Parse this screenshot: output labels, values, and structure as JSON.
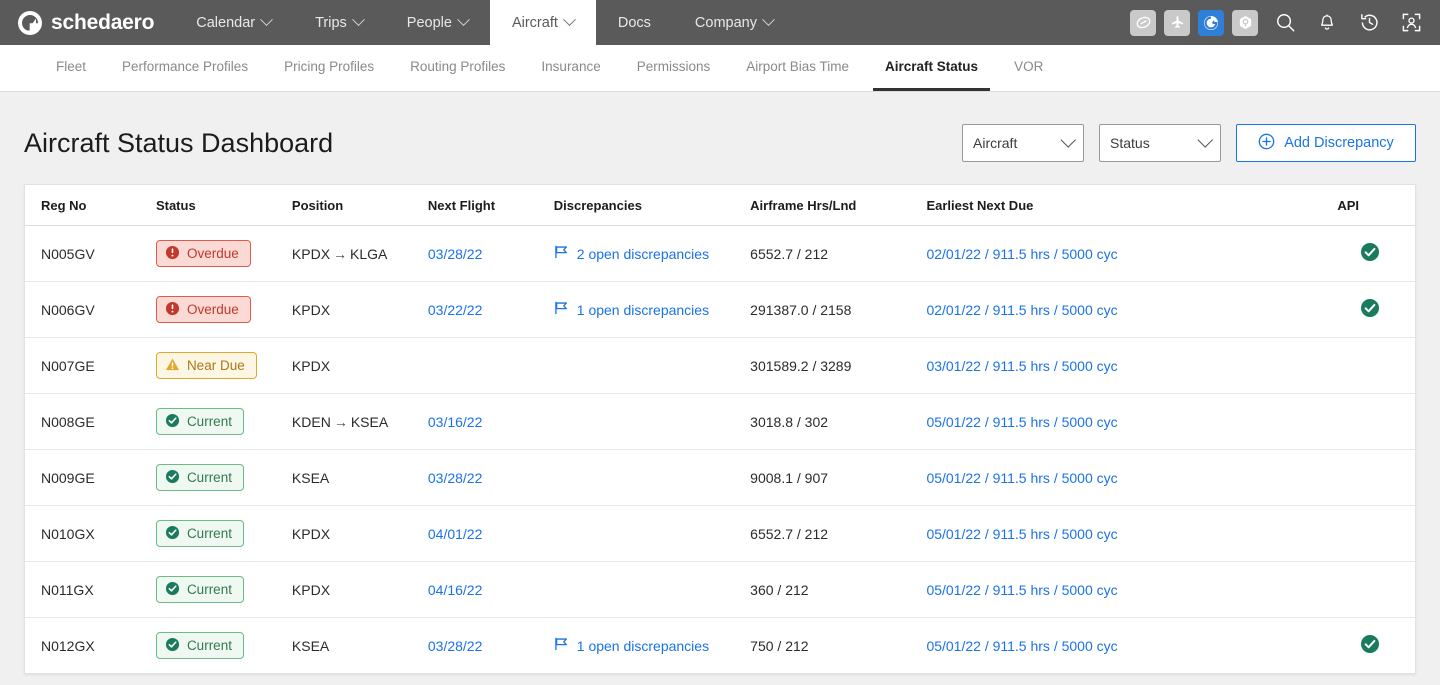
{
  "brand": {
    "name": "schedaero",
    "logo_icon": "swoosh-circle-icon"
  },
  "topnav": {
    "items": [
      {
        "label": "Calendar",
        "has_caret": true,
        "active": false
      },
      {
        "label": "Trips",
        "has_caret": true,
        "active": false
      },
      {
        "label": "People",
        "has_caret": true,
        "active": false
      },
      {
        "label": "Aircraft",
        "has_caret": true,
        "active": true
      },
      {
        "label": "Docs",
        "has_caret": false,
        "active": false
      },
      {
        "label": "Company",
        "has_caret": true,
        "active": false
      }
    ],
    "app_tiles": [
      {
        "icon": "meatball-swoosh-icon",
        "selected": false
      },
      {
        "icon": "airplane-icon",
        "selected": false
      },
      {
        "icon": "schedaero-icon",
        "selected": true
      },
      {
        "icon": "hexagon-p-icon",
        "selected": false
      }
    ],
    "icons": [
      {
        "icon": "search-icon"
      },
      {
        "icon": "bell-icon"
      },
      {
        "icon": "history-clock-icon"
      },
      {
        "icon": "user-frame-icon"
      }
    ],
    "accent_selected": "#2f7ed8",
    "bar_color": "#5a5a5a"
  },
  "subnav": {
    "items": [
      {
        "label": "Fleet",
        "active": false
      },
      {
        "label": "Performance Profiles",
        "active": false
      },
      {
        "label": "Pricing Profiles",
        "active": false
      },
      {
        "label": "Routing Profiles",
        "active": false
      },
      {
        "label": "Insurance",
        "active": false
      },
      {
        "label": "Permissions",
        "active": false
      },
      {
        "label": "Airport Bias Time",
        "active": false
      },
      {
        "label": "Aircraft Status",
        "active": true
      },
      {
        "label": "VOR",
        "active": false
      }
    ]
  },
  "page": {
    "title": "Aircraft Status Dashboard",
    "filter_aircraft": {
      "value": "Aircraft",
      "icon": "chevron-down-icon"
    },
    "filter_status": {
      "value": "Status",
      "icon": "chevron-down-icon"
    },
    "add_button": {
      "label": "Add Discrepancy",
      "icon": "plus-circle-icon",
      "color": "#1a73e8"
    }
  },
  "table": {
    "columns": [
      "Reg No",
      "Status",
      "Position",
      "Next Flight",
      "Discrepancies",
      "Airframe Hrs/Lnd",
      "Earliest Next Due",
      "API"
    ],
    "rows": [
      {
        "reg_no": "N005GV",
        "status": {
          "label": "Overdue",
          "kind": "overdue",
          "icon": "exclamation-circle-icon"
        },
        "position": {
          "from": "KPDX",
          "to": "KLGA",
          "text": "KPDX → KLGA"
        },
        "next_flight": "03/28/22",
        "discrepancies": {
          "label": "2 open discrepancies",
          "icon": "flag-icon"
        },
        "airframe": "6552.7 / 212",
        "earliest_next_due": "02/01/22 / 911.5 hrs / 5000 cyc",
        "api": true
      },
      {
        "reg_no": "N006GV",
        "status": {
          "label": "Overdue",
          "kind": "overdue",
          "icon": "exclamation-circle-icon"
        },
        "position": {
          "from": "KPDX",
          "to": "",
          "text": "KPDX"
        },
        "next_flight": "03/22/22",
        "discrepancies": {
          "label": "1 open discrepancies",
          "icon": "flag-icon"
        },
        "airframe": "291387.0 / 2158",
        "earliest_next_due": "02/01/22 / 911.5 hrs / 5000 cyc",
        "api": true
      },
      {
        "reg_no": "N007GE",
        "status": {
          "label": "Near Due",
          "kind": "neardue",
          "icon": "warning-triangle-icon"
        },
        "position": {
          "from": "KPDX",
          "to": "",
          "text": "KPDX"
        },
        "next_flight": "",
        "discrepancies": null,
        "airframe": "301589.2 / 3289",
        "earliest_next_due": "03/01/22 / 911.5 hrs / 5000 cyc",
        "api": false
      },
      {
        "reg_no": "N008GE",
        "status": {
          "label": "Current",
          "kind": "current",
          "icon": "check-circle-icon"
        },
        "position": {
          "from": "KDEN",
          "to": "KSEA",
          "text": "KDEN → KSEA"
        },
        "next_flight": "03/16/22",
        "discrepancies": null,
        "airframe": "3018.8 / 302",
        "earliest_next_due": "05/01/22 / 911.5 hrs / 5000 cyc",
        "api": false
      },
      {
        "reg_no": "N009GE",
        "status": {
          "label": "Current",
          "kind": "current",
          "icon": "check-circle-icon"
        },
        "position": {
          "from": "KSEA",
          "to": "",
          "text": "KSEA"
        },
        "next_flight": "03/28/22",
        "discrepancies": null,
        "airframe": "9008.1 / 907",
        "earliest_next_due": "05/01/22 / 911.5 hrs / 5000 cyc",
        "api": false
      },
      {
        "reg_no": "N010GX",
        "status": {
          "label": "Current",
          "kind": "current",
          "icon": "check-circle-icon"
        },
        "position": {
          "from": "KPDX",
          "to": "",
          "text": "KPDX"
        },
        "next_flight": "04/01/22",
        "discrepancies": null,
        "airframe": "6552.7 / 212",
        "earliest_next_due": "05/01/22 / 911.5 hrs / 5000 cyc",
        "api": false
      },
      {
        "reg_no": "N011GX",
        "status": {
          "label": "Current",
          "kind": "current",
          "icon": "check-circle-icon"
        },
        "position": {
          "from": "KPDX",
          "to": "",
          "text": "KPDX"
        },
        "next_flight": "04/16/22",
        "discrepancies": null,
        "airframe": "360 / 212",
        "earliest_next_due": "05/01/22 / 911.5 hrs / 5000 cyc",
        "api": false
      },
      {
        "reg_no": "N012GX",
        "status": {
          "label": "Current",
          "kind": "current",
          "icon": "check-circle-icon"
        },
        "position": {
          "from": "KSEA",
          "to": "",
          "text": "KSEA"
        },
        "next_flight": "03/28/22",
        "discrepancies": {
          "label": "1 open discrepancies",
          "icon": "flag-icon"
        },
        "airframe": "750 / 212",
        "earliest_next_due": "05/01/22 / 911.5 hrs / 5000 cyc",
        "api": true
      }
    ]
  },
  "colors": {
    "overdue": "#c0392b",
    "near_due": "#a9791d",
    "current": "#2f7a4f",
    "link": "#1a73e8",
    "api_check": "#1a7a5e"
  }
}
